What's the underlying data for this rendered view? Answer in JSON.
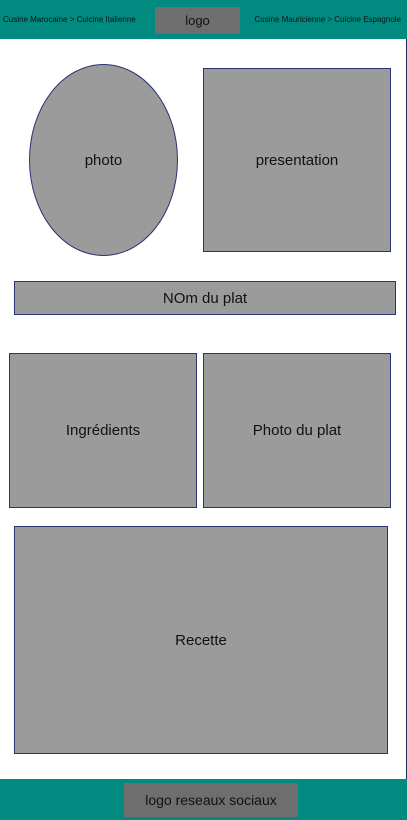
{
  "header": {
    "nav_left": "Cusine Marocaine > Cuicine Italienne",
    "logo": "logo",
    "nav_right": "Cusine Mauricienne > Cuicine Espagnole"
  },
  "main": {
    "photo": "photo",
    "presentation": "presentation",
    "dish_name": "NOm du plat",
    "ingredients": "Ingrédients",
    "dish_photo": "Photo du plat",
    "recipe": "Recette"
  },
  "footer": {
    "social_logo": "logo reseaux sociaux"
  },
  "colors": {
    "header_footer_bg": "#008a80",
    "placeholder_fill": "#9b9b9b",
    "logo_fill": "#6e6e6e",
    "border": "#2a3374"
  }
}
